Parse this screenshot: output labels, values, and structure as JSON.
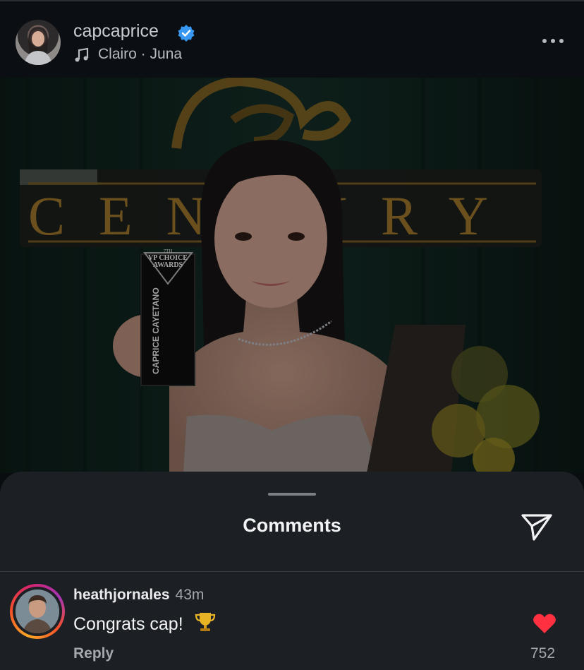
{
  "post": {
    "username": "capcaprice",
    "music": "Clairo · Juna",
    "photo_texts": {
      "sign": "CENTURY",
      "award_top_1": "7TH",
      "award_top_2": "VP CHOICE",
      "award_top_3": "AWARDS",
      "award_name": "CAPRICE CAYETANO"
    }
  },
  "comments_sheet": {
    "title": "Comments",
    "comments": [
      {
        "username": "heathjornales",
        "time": "43m",
        "text": "Congrats cap!",
        "reply_label": "Reply",
        "likes": "752",
        "liked": true
      }
    ]
  },
  "colors": {
    "verified": "#3897f0",
    "heart": "#ff3040",
    "sheet_bg": "#1c1f23"
  },
  "icons": [
    "verified-badge-icon",
    "music-note-icon",
    "more-options-icon",
    "send-icon",
    "trophy-icon",
    "heart-icon"
  ]
}
